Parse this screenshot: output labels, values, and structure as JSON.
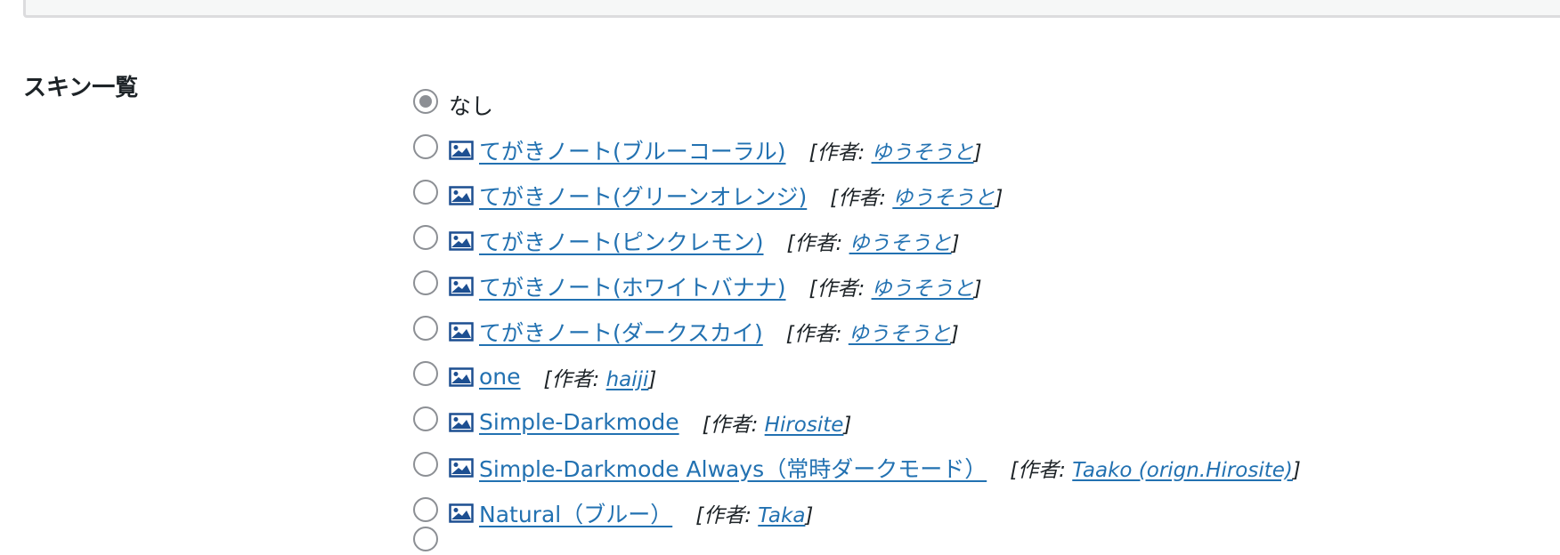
{
  "section": {
    "label": "スキン一覧"
  },
  "none_option": {
    "label": "なし",
    "checked": true
  },
  "author_prefix": "[作者: ",
  "author_suffix": "]",
  "skins": [
    {
      "name": "てがきノート(ブルーコーラル)",
      "author": "ゆうそうと"
    },
    {
      "name": "てがきノート(グリーンオレンジ)",
      "author": "ゆうそうと"
    },
    {
      "name": "てがきノート(ピンクレモン)",
      "author": "ゆうそうと"
    },
    {
      "name": "てがきノート(ホワイトバナナ)",
      "author": "ゆうそうと"
    },
    {
      "name": "てがきノート(ダークスカイ)",
      "author": "ゆうそうと"
    },
    {
      "name": "one",
      "author": "haiji"
    },
    {
      "name": "Simple-Darkmode",
      "author": "Hirosite"
    },
    {
      "name": "Simple-Darkmode Always（常時ダークモード）",
      "author": "Taako (orign.Hirosite)"
    },
    {
      "name": "Natural（ブルー）",
      "author": "Taka"
    }
  ],
  "colors": {
    "link": "#2271b1",
    "text": "#1d2327",
    "radio_border": "#8c8f94"
  }
}
